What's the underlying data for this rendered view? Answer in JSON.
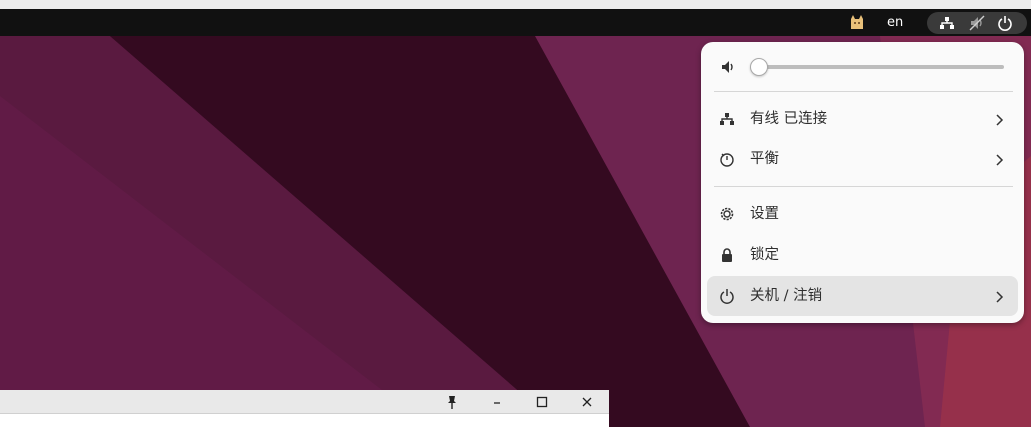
{
  "panel": {
    "language": "en",
    "tray_icons": [
      "cat-app-icon",
      "network-wired-icon",
      "volume-muted-icon",
      "power-icon"
    ]
  },
  "quick_settings": {
    "volume": {
      "level": 0.0,
      "icon": "volume-icon"
    },
    "items": [
      {
        "label": "有线 已连接",
        "icon": "network-wired-icon",
        "has_submenu": true
      },
      {
        "label": "平衡",
        "icon": "power-profile-icon",
        "has_submenu": true
      },
      {
        "label": "设置",
        "icon": "settings-gear-icon",
        "has_submenu": false
      },
      {
        "label": "锁定",
        "icon": "lock-icon",
        "has_submenu": false
      },
      {
        "label": "关机 / 注销",
        "icon": "power-icon",
        "has_submenu": true,
        "highlighted": true
      }
    ]
  },
  "window": {
    "buttons": [
      "pin-icon",
      "minimize-icon",
      "maximize-icon",
      "close-icon"
    ]
  },
  "colors": {
    "panel_bg": "#111111",
    "menu_bg": "#fafafa",
    "wallpaper_base": "#2c0a1e",
    "wallpaper_accent": "#7a2a58"
  }
}
